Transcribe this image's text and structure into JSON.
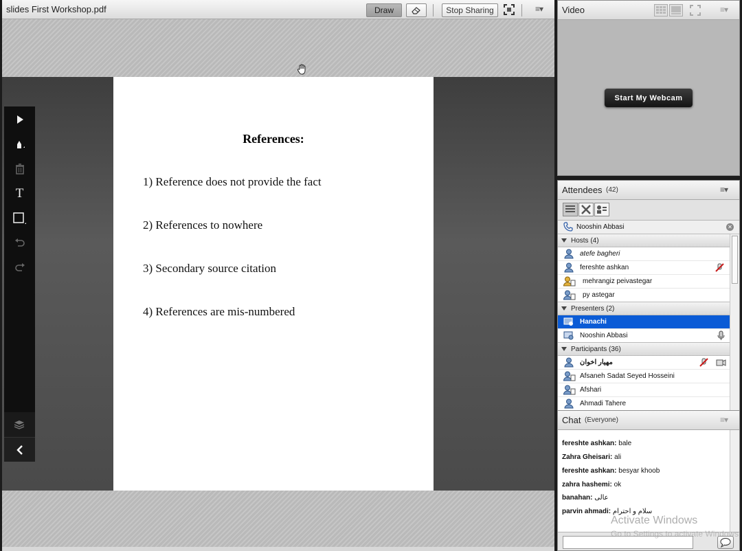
{
  "share_pod": {
    "title": "slides First Workshop.pdf",
    "draw_label": "Draw",
    "stop_sharing_label": "Stop Sharing",
    "menu_label": "≡▾"
  },
  "document": {
    "title": "References:",
    "items": [
      "1) Reference does not provide the fact",
      "2) References to nowhere",
      "3) Secondary source citation",
      "4) References are mis-numbered"
    ]
  },
  "video_pod": {
    "title": "Video",
    "webcam_button": "Start My Webcam",
    "menu_label": "≡▾"
  },
  "attendees_pod": {
    "title": "Attendees",
    "count": "(42)",
    "menu_label": "≡▾",
    "search_value": "Nooshin Abbasi",
    "groups": [
      {
        "label": "Hosts (4)"
      },
      {
        "label": "Presenters (2)"
      },
      {
        "label": "Participants (36)"
      }
    ],
    "hosts": [
      "atefe bagheri",
      "fereshte ashkan",
      "mehrangiz peivastegar",
      "py astegar"
    ],
    "presenters": [
      "Hanachi",
      "Nooshin Abbasi"
    ],
    "participants": [
      "مهیار اخوان",
      "Afsaneh Sadat Seyed Hosseini",
      "Afshari",
      "Ahmadi Tahere"
    ]
  },
  "chat_pod": {
    "title": "Chat",
    "scope": "(Everyone)",
    "menu_label": "≡▾",
    "messages": [
      {
        "sender": "fereshte ashkan:",
        "text": "bale"
      },
      {
        "sender": "Zahra Gheisari:",
        "text": "ali"
      },
      {
        "sender": "fereshte ashkan:",
        "text": "besyar khoob"
      },
      {
        "sender": "zahra hashemi:",
        "text": "ok"
      },
      {
        "sender": "banahan:",
        "text": "عالی"
      },
      {
        "sender": "parvin ahmadi:",
        "text": "سلام و احترام"
      }
    ]
  },
  "watermark": {
    "line1": "Activate Windows",
    "line2": "Go to Settings to activate Windows."
  }
}
